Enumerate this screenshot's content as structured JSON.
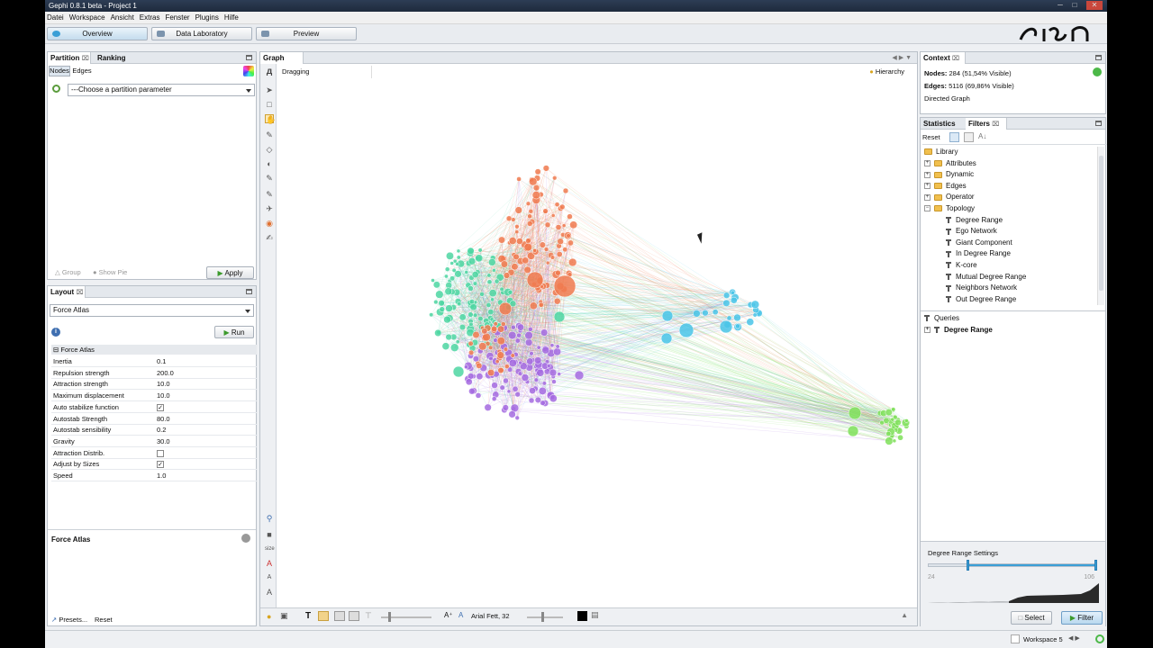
{
  "window": {
    "title": "Gephi 0.8.1 beta - Project 1"
  },
  "menu": [
    "Datei",
    "Workspace",
    "Ansicht",
    "Extras",
    "Fenster",
    "Plugins",
    "Hilfe"
  ],
  "main_tabs": {
    "overview": "Overview",
    "data_laboratory": "Data Laboratory",
    "preview": "Preview"
  },
  "partition_panel": {
    "tabs": [
      "Partition",
      "Ranking"
    ],
    "subtabs": [
      "Nodes",
      "Edges"
    ],
    "parameter_dropdown": "---Choose a partition parameter",
    "group_label": "Group",
    "show_pie_label": "Show Pie",
    "apply_label": "Apply"
  },
  "layout_panel": {
    "title": "Layout",
    "algorithm": "Force Atlas",
    "run_label": "Run",
    "section": "Force Atlas",
    "properties": [
      {
        "name": "Inertia",
        "value": "0.1"
      },
      {
        "name": "Repulsion strength",
        "value": "200.0"
      },
      {
        "name": "Attraction strength",
        "value": "10.0"
      },
      {
        "name": "Maximum displacement",
        "value": "10.0"
      },
      {
        "name": "Auto stabilize function",
        "checked": true
      },
      {
        "name": "Autostab Strength",
        "value": "80.0"
      },
      {
        "name": "Autostab sensibility",
        "value": "0.2"
      },
      {
        "name": "Gravity",
        "value": "30.0"
      },
      {
        "name": "Attraction Distrib.",
        "checked": false
      },
      {
        "name": "Adjust by Sizes",
        "checked": true
      },
      {
        "name": "Speed",
        "value": "1.0"
      }
    ],
    "description_title": "Force Atlas",
    "presets_label": "Presets...",
    "reset_label": "Reset"
  },
  "graph_panel": {
    "tab": "Graph",
    "mode": "Dragging",
    "hierarchy_label": "Hierarchy",
    "font_label": "Arial Fett, 32"
  },
  "context_panel": {
    "title": "Context",
    "nodes_label": "Nodes:",
    "nodes_value": "284 (51,54% Visible)",
    "edges_label": "Edges:",
    "edges_value": "5116 (69,86% Visible)",
    "graph_type": "Directed Graph"
  },
  "filters_panel": {
    "tabs": [
      "Statistics",
      "Filters"
    ],
    "reset_label": "Reset",
    "library_label": "Library",
    "categories": [
      "Attributes",
      "Dynamic",
      "Edges",
      "Operator",
      "Topology"
    ],
    "topology_items": [
      "Degree Range",
      "Ego Network",
      "Giant Component",
      "In Degree Range",
      "K-core",
      "Mutual Degree Range",
      "Neighbors Network",
      "Out Degree Range"
    ],
    "queries_label": "Queries",
    "query_item": "Degree Range",
    "settings_title": "Degree Range Settings",
    "range_min": "24",
    "range_max": "106",
    "select_label": "Select",
    "filter_label": "Filter"
  },
  "status": {
    "workspace": "Workspace 5"
  },
  "colors": {
    "accent": "#3a9fd6",
    "cluster_orange": "#f07a4f",
    "cluster_green": "#4dd6a2",
    "cluster_purple": "#a56be0",
    "cluster_cyan": "#49c4e8",
    "cluster_lime": "#7fe05a"
  }
}
